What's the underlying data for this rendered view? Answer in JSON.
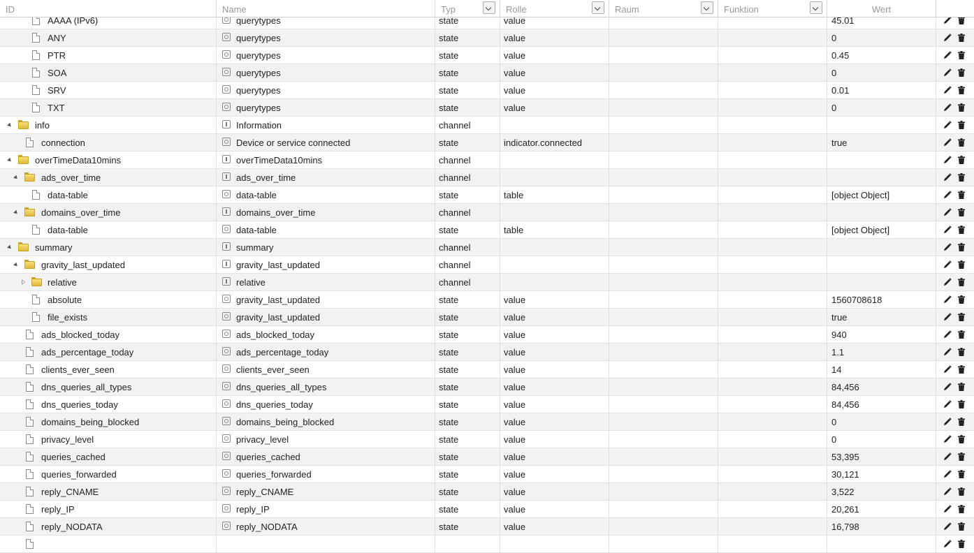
{
  "columns": {
    "id": "ID",
    "name": "Name",
    "typ": "Typ",
    "rolle": "Rolle",
    "raum": "Raum",
    "funktion": "Funktion",
    "wert": "Wert"
  },
  "icons": {
    "edit": "pencil-icon",
    "delete": "trash-icon",
    "folder": "folder-icon",
    "file": "file-icon"
  },
  "rows": [
    {
      "id": "AAAA (IPv6)",
      "kind": "file",
      "level": 3,
      "tree": "",
      "nicon": "state",
      "name": "querytypes",
      "typ": "state",
      "rolle": "value",
      "wert": "45.01"
    },
    {
      "id": "ANY",
      "kind": "file",
      "level": 3,
      "tree": "",
      "nicon": "state",
      "name": "querytypes",
      "typ": "state",
      "rolle": "value",
      "wert": "0"
    },
    {
      "id": "PTR",
      "kind": "file",
      "level": 3,
      "tree": "",
      "nicon": "state",
      "name": "querytypes",
      "typ": "state",
      "rolle": "value",
      "wert": "0.45"
    },
    {
      "id": "SOA",
      "kind": "file",
      "level": 3,
      "tree": "",
      "nicon": "state",
      "name": "querytypes",
      "typ": "state",
      "rolle": "value",
      "wert": "0"
    },
    {
      "id": "SRV",
      "kind": "file",
      "level": 3,
      "tree": "",
      "nicon": "state",
      "name": "querytypes",
      "typ": "state",
      "rolle": "value",
      "wert": "0.01"
    },
    {
      "id": "TXT",
      "kind": "file",
      "level": 3,
      "tree": "",
      "nicon": "state",
      "name": "querytypes",
      "typ": "state",
      "rolle": "value",
      "wert": "0"
    },
    {
      "id": "info",
      "kind": "folder",
      "level": 1,
      "tree": "open",
      "nicon": "channel",
      "name": "Information",
      "typ": "channel",
      "rolle": "",
      "wert": ""
    },
    {
      "id": "connection",
      "kind": "file",
      "level": 2,
      "tree": "",
      "nicon": "state",
      "name": "Device or service connected",
      "typ": "state",
      "rolle": "indicator.connected",
      "wert": "true"
    },
    {
      "id": "overTimeData10mins",
      "kind": "folder",
      "level": 1,
      "tree": "open",
      "nicon": "channel",
      "name": "overTimeData10mins",
      "typ": "channel",
      "rolle": "",
      "wert": ""
    },
    {
      "id": "ads_over_time",
      "kind": "folder",
      "level": 2,
      "tree": "open",
      "nicon": "channel",
      "name": "ads_over_time",
      "typ": "channel",
      "rolle": "",
      "wert": ""
    },
    {
      "id": "data-table",
      "kind": "file",
      "level": 3,
      "tree": "",
      "nicon": "state",
      "name": "data-table",
      "typ": "state",
      "rolle": "table",
      "wert": "[object Object]"
    },
    {
      "id": "domains_over_time",
      "kind": "folder",
      "level": 2,
      "tree": "open",
      "nicon": "channel",
      "name": "domains_over_time",
      "typ": "channel",
      "rolle": "",
      "wert": ""
    },
    {
      "id": "data-table",
      "kind": "file",
      "level": 3,
      "tree": "",
      "nicon": "state",
      "name": "data-table",
      "typ": "state",
      "rolle": "table",
      "wert": "[object Object]"
    },
    {
      "id": "summary",
      "kind": "folder",
      "level": 1,
      "tree": "open",
      "nicon": "channel",
      "name": "summary",
      "typ": "channel",
      "rolle": "",
      "wert": ""
    },
    {
      "id": "gravity_last_updated",
      "kind": "folder",
      "level": 2,
      "tree": "open",
      "nicon": "channel",
      "name": "gravity_last_updated",
      "typ": "channel",
      "rolle": "",
      "wert": ""
    },
    {
      "id": "relative",
      "kind": "folder",
      "level": 3,
      "tree": "closed",
      "nicon": "channel",
      "name": "relative",
      "typ": "channel",
      "rolle": "",
      "wert": ""
    },
    {
      "id": "absolute",
      "kind": "file",
      "level": 3,
      "tree": "",
      "nicon": "state",
      "name": "gravity_last_updated",
      "typ": "state",
      "rolle": "value",
      "wert": "1560708618"
    },
    {
      "id": "file_exists",
      "kind": "file",
      "level": 3,
      "tree": "",
      "nicon": "state",
      "name": "gravity_last_updated",
      "typ": "state",
      "rolle": "value",
      "wert": "true"
    },
    {
      "id": "ads_blocked_today",
      "kind": "file",
      "level": 2,
      "tree": "",
      "nicon": "state",
      "name": "ads_blocked_today",
      "typ": "state",
      "rolle": "value",
      "wert": "940"
    },
    {
      "id": "ads_percentage_today",
      "kind": "file",
      "level": 2,
      "tree": "",
      "nicon": "state",
      "name": "ads_percentage_today",
      "typ": "state",
      "rolle": "value",
      "wert": "1.1"
    },
    {
      "id": "clients_ever_seen",
      "kind": "file",
      "level": 2,
      "tree": "",
      "nicon": "state",
      "name": "clients_ever_seen",
      "typ": "state",
      "rolle": "value",
      "wert": "14"
    },
    {
      "id": "dns_queries_all_types",
      "kind": "file",
      "level": 2,
      "tree": "",
      "nicon": "state",
      "name": "dns_queries_all_types",
      "typ": "state",
      "rolle": "value",
      "wert": "84,456"
    },
    {
      "id": "dns_queries_today",
      "kind": "file",
      "level": 2,
      "tree": "",
      "nicon": "state",
      "name": "dns_queries_today",
      "typ": "state",
      "rolle": "value",
      "wert": "84,456"
    },
    {
      "id": "domains_being_blocked",
      "kind": "file",
      "level": 2,
      "tree": "",
      "nicon": "state",
      "name": "domains_being_blocked",
      "typ": "state",
      "rolle": "value",
      "wert": "0"
    },
    {
      "id": "privacy_level",
      "kind": "file",
      "level": 2,
      "tree": "",
      "nicon": "state",
      "name": "privacy_level",
      "typ": "state",
      "rolle": "value",
      "wert": "0"
    },
    {
      "id": "queries_cached",
      "kind": "file",
      "level": 2,
      "tree": "",
      "nicon": "state",
      "name": "queries_cached",
      "typ": "state",
      "rolle": "value",
      "wert": "53,395"
    },
    {
      "id": "queries_forwarded",
      "kind": "file",
      "level": 2,
      "tree": "",
      "nicon": "state",
      "name": "queries_forwarded",
      "typ": "state",
      "rolle": "value",
      "wert": "30,121"
    },
    {
      "id": "reply_CNAME",
      "kind": "file",
      "level": 2,
      "tree": "",
      "nicon": "state",
      "name": "reply_CNAME",
      "typ": "state",
      "rolle": "value",
      "wert": "3,522"
    },
    {
      "id": "reply_IP",
      "kind": "file",
      "level": 2,
      "tree": "",
      "nicon": "state",
      "name": "reply_IP",
      "typ": "state",
      "rolle": "value",
      "wert": "20,261"
    },
    {
      "id": "reply_NODATA",
      "kind": "file",
      "level": 2,
      "tree": "",
      "nicon": "state",
      "name": "reply_NODATA",
      "typ": "state",
      "rolle": "value",
      "wert": "16,798"
    },
    {
      "id": "",
      "kind": "file",
      "level": 2,
      "tree": "",
      "nicon": "state",
      "name": "",
      "typ": "",
      "rolle": "",
      "wert": ""
    }
  ]
}
